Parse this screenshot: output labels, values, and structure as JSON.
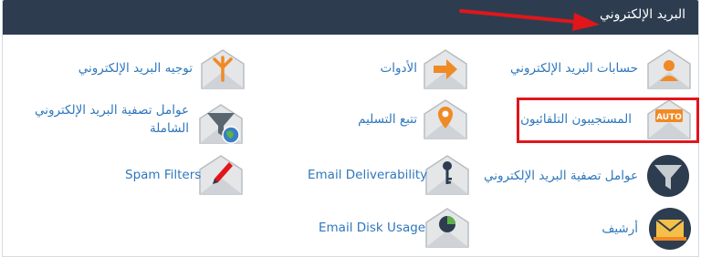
{
  "header": {
    "title": "البريد الإلكتروني"
  },
  "items": [
    {
      "label": "حسابات البريد الإلكتروني",
      "icon": "email-account-icon"
    },
    {
      "label": "الأدوات",
      "icon": "forwarders-icon"
    },
    {
      "label": "توجيه البريد الإلكتروني",
      "icon": "email-routing-icon"
    },
    {
      "label": "المستجيبون التلقائيون",
      "icon": "autoresponders-icon",
      "badge": "AUTO"
    },
    {
      "label": "تتبع التسليم",
      "icon": "track-delivery-icon"
    },
    {
      "label": "عوامل تصفية البريد الإلكتروني الشاملة",
      "label_line1": "عوامل تصفية البريد الإلكتروني",
      "label_line2": "الشاملة",
      "icon": "global-email-filters-icon"
    },
    {
      "label": "عوامل تصفية البريد الإلكتروني",
      "icon": "email-filters-icon"
    },
    {
      "label": "Email Deliverability",
      "icon": "email-deliverability-icon"
    },
    {
      "label": "Spam Filters",
      "icon": "spam-filters-icon"
    },
    {
      "label": "أرشيف",
      "icon": "archive-icon"
    },
    {
      "label": "Email Disk Usage",
      "icon": "email-disk-usage-icon"
    }
  ],
  "colors": {
    "header_bg": "#2d3d4f",
    "link": "#2e77bc",
    "accent_orange": "#f08a24",
    "highlight": "#e0161b",
    "envelope": "#bfc4c8",
    "dark_circle": "#2d3d4f"
  }
}
